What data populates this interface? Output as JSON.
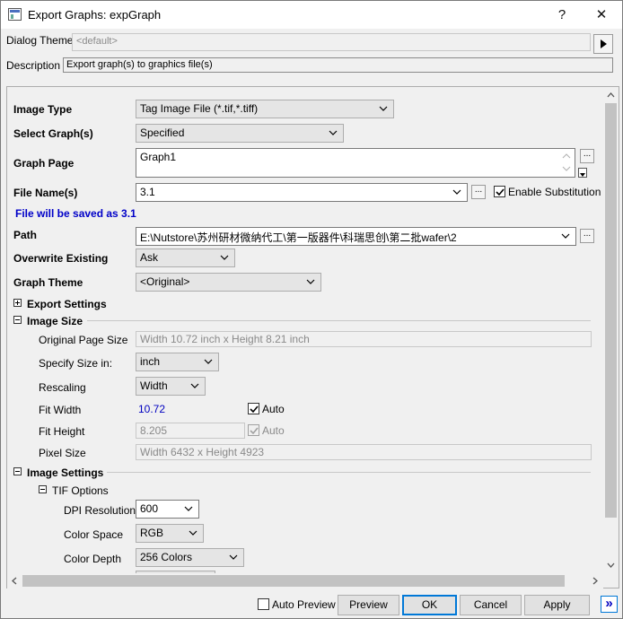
{
  "window": {
    "title": "Export Graphs: expGraph",
    "help": "?",
    "close": "✕"
  },
  "theme": {
    "label": "Dialog Theme",
    "value": "<default>"
  },
  "description": {
    "label": "Description",
    "value": "Export graph(s) to graphics file(s)"
  },
  "image_type": {
    "label": "Image Type",
    "value": "Tag Image File (*.tif,*.tiff)"
  },
  "select_graphs": {
    "label": "Select Graph(s)",
    "value": "Specified"
  },
  "graph_page": {
    "label": "Graph Page",
    "value": "Graph1",
    "browse": "..."
  },
  "file_name": {
    "label": "File Name(s)",
    "value": "3.1",
    "browse": "...",
    "enable_sub_label": "Enable Substitution",
    "enable_sub_checked": true
  },
  "save_note": "File will be saved as 3.1",
  "path": {
    "label": "Path",
    "value": "E:\\Nutstore\\苏州研材微纳代工\\第一版器件\\科瑞思创\\第二批wafer\\2",
    "browse": "..."
  },
  "overwrite": {
    "label": "Overwrite Existing",
    "value": "Ask"
  },
  "graph_theme": {
    "label": "Graph Theme",
    "value": "<Original>"
  },
  "export_settings": {
    "label": "Export Settings",
    "expanded": false
  },
  "image_size": {
    "label": "Image Size",
    "original_page_size_label": "Original Page Size",
    "original_page_size": "Width 10.72 inch x Height 8.21 inch",
    "specify_size_label": "Specify Size in:",
    "specify_size": "inch",
    "rescaling_label": "Rescaling",
    "rescaling": "Width",
    "fit_width_label": "Fit Width",
    "fit_width": "10.72",
    "fit_width_auto_label": "Auto",
    "fit_width_auto": true,
    "fit_height_label": "Fit Height",
    "fit_height": "8.205",
    "fit_height_auto_label": "Auto",
    "fit_height_auto": true,
    "pixel_size_label": "Pixel Size",
    "pixel_size": "Width 6432 x Height 4923"
  },
  "image_settings": {
    "label": "Image Settings",
    "tif_options_label": "TIF Options",
    "dpi_label": "DPI Resolution",
    "dpi": "600",
    "color_space_label": "Color Space",
    "color_space": "RGB",
    "color_depth_label": "Color Depth",
    "color_depth": "256 Colors"
  },
  "footer": {
    "auto_preview_label": "Auto Preview",
    "auto_preview": false,
    "preview": "Preview",
    "ok": "OK",
    "cancel": "Cancel",
    "apply": "Apply",
    "more": "»"
  },
  "colors": {
    "accent": "#0078d7",
    "note_blue": "#0000c8",
    "value_blue": "#0000c0"
  }
}
